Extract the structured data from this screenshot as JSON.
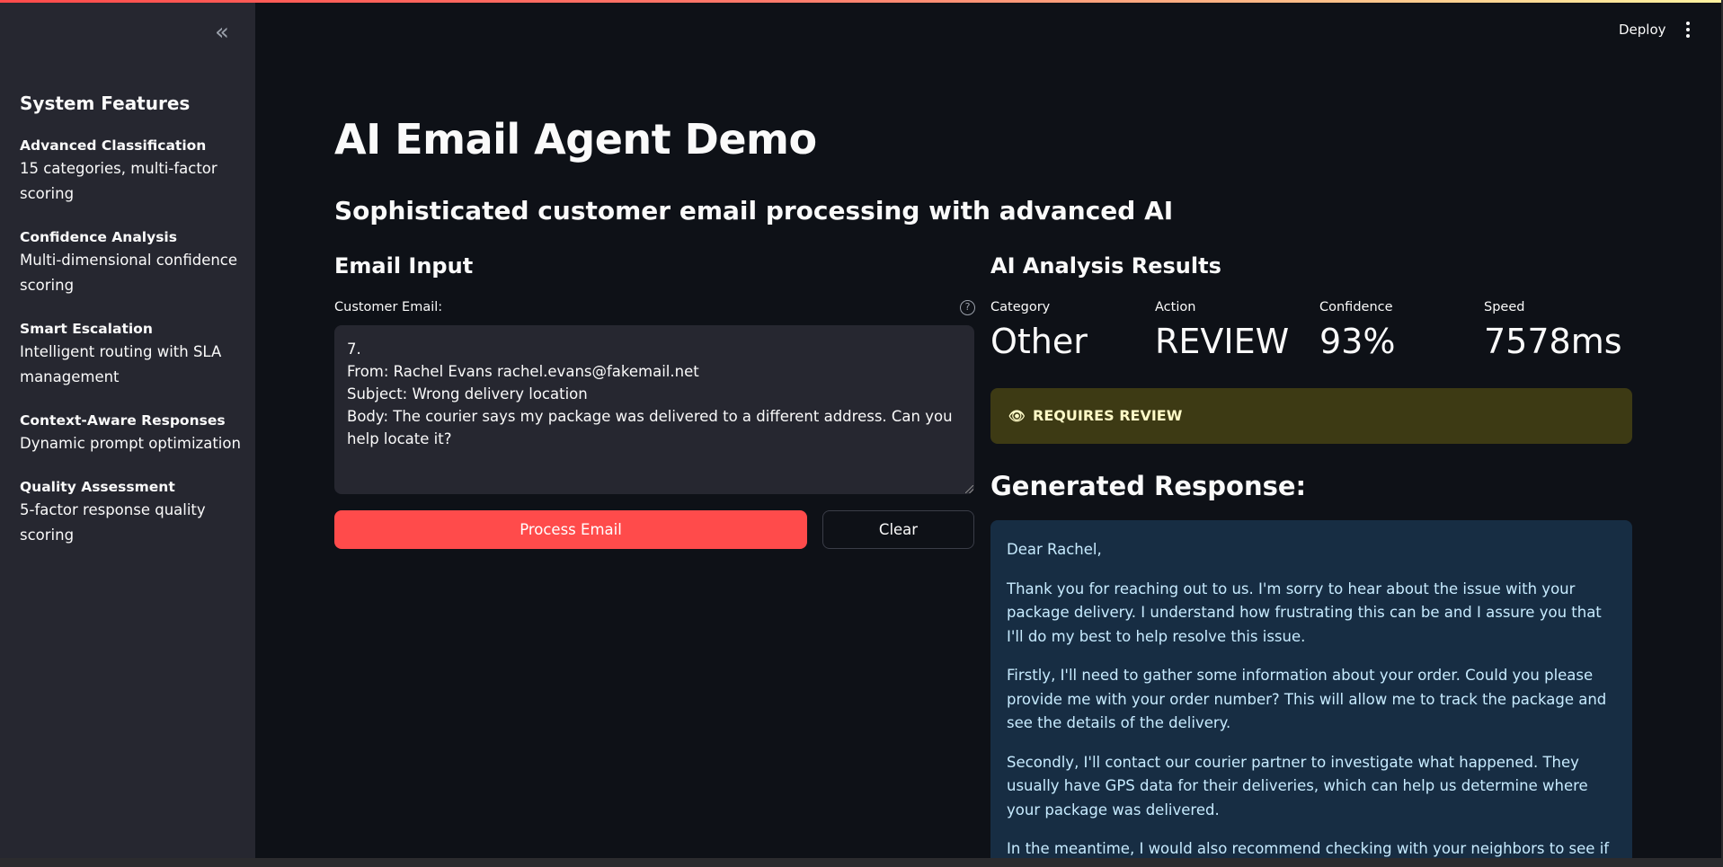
{
  "sidebar": {
    "heading": "System Features",
    "features": [
      {
        "title": "Advanced Classification",
        "desc": "15 categories, multi-factor scoring"
      },
      {
        "title": "Confidence Analysis",
        "desc": "Multi-dimensional confidence scoring"
      },
      {
        "title": "Smart Escalation",
        "desc": "Intelligent routing with SLA management"
      },
      {
        "title": "Context-Aware Responses",
        "desc": "Dynamic prompt optimization"
      },
      {
        "title": "Quality Assessment",
        "desc": "5-factor response quality scoring"
      }
    ]
  },
  "header": {
    "deploy_label": "Deploy"
  },
  "main": {
    "title": "AI Email Agent Demo",
    "subtitle": "Sophisticated customer email processing with advanced AI",
    "input": {
      "heading": "Email Input",
      "label": "Customer Email:",
      "value": "7.\nFrom: Rachel Evans rachel.evans@fakemail.net\nSubject: Wrong delivery location\nBody: The courier says my package was delivered to a different address. Can you help locate it?",
      "process_label": "Process Email",
      "clear_label": "Clear"
    },
    "results": {
      "heading": "AI Analysis Results",
      "metrics": [
        {
          "label": "Category",
          "value": "Other"
        },
        {
          "label": "Action",
          "value": "REVIEW"
        },
        {
          "label": "Confidence",
          "value": "93%"
        },
        {
          "label": "Speed",
          "value": "7578ms"
        }
      ],
      "banner": "REQUIRES REVIEW",
      "response_heading": "Generated Response:",
      "response_paragraphs": [
        "Dear Rachel,",
        "Thank you for reaching out to us. I'm sorry to hear about the issue with your package delivery. I understand how frustrating this can be and I assure you that I'll do my best to help resolve this issue.",
        "Firstly, I'll need to gather some information about your order. Could you please provide me with your order number? This will allow me to track the package and see the details of the delivery.",
        "Secondly, I'll contact our courier partner to investigate what happened. They usually have GPS data for their deliveries, which can help us determine where your package was delivered.",
        "In the meantime, I would also recommend checking with your neighbors to see if the"
      ]
    }
  },
  "colors": {
    "primary": "#ff4b4b",
    "background": "#0e1117",
    "sidebar": "#262730",
    "warning_bg": "#3d3a14",
    "info_bg": "#172d43"
  }
}
